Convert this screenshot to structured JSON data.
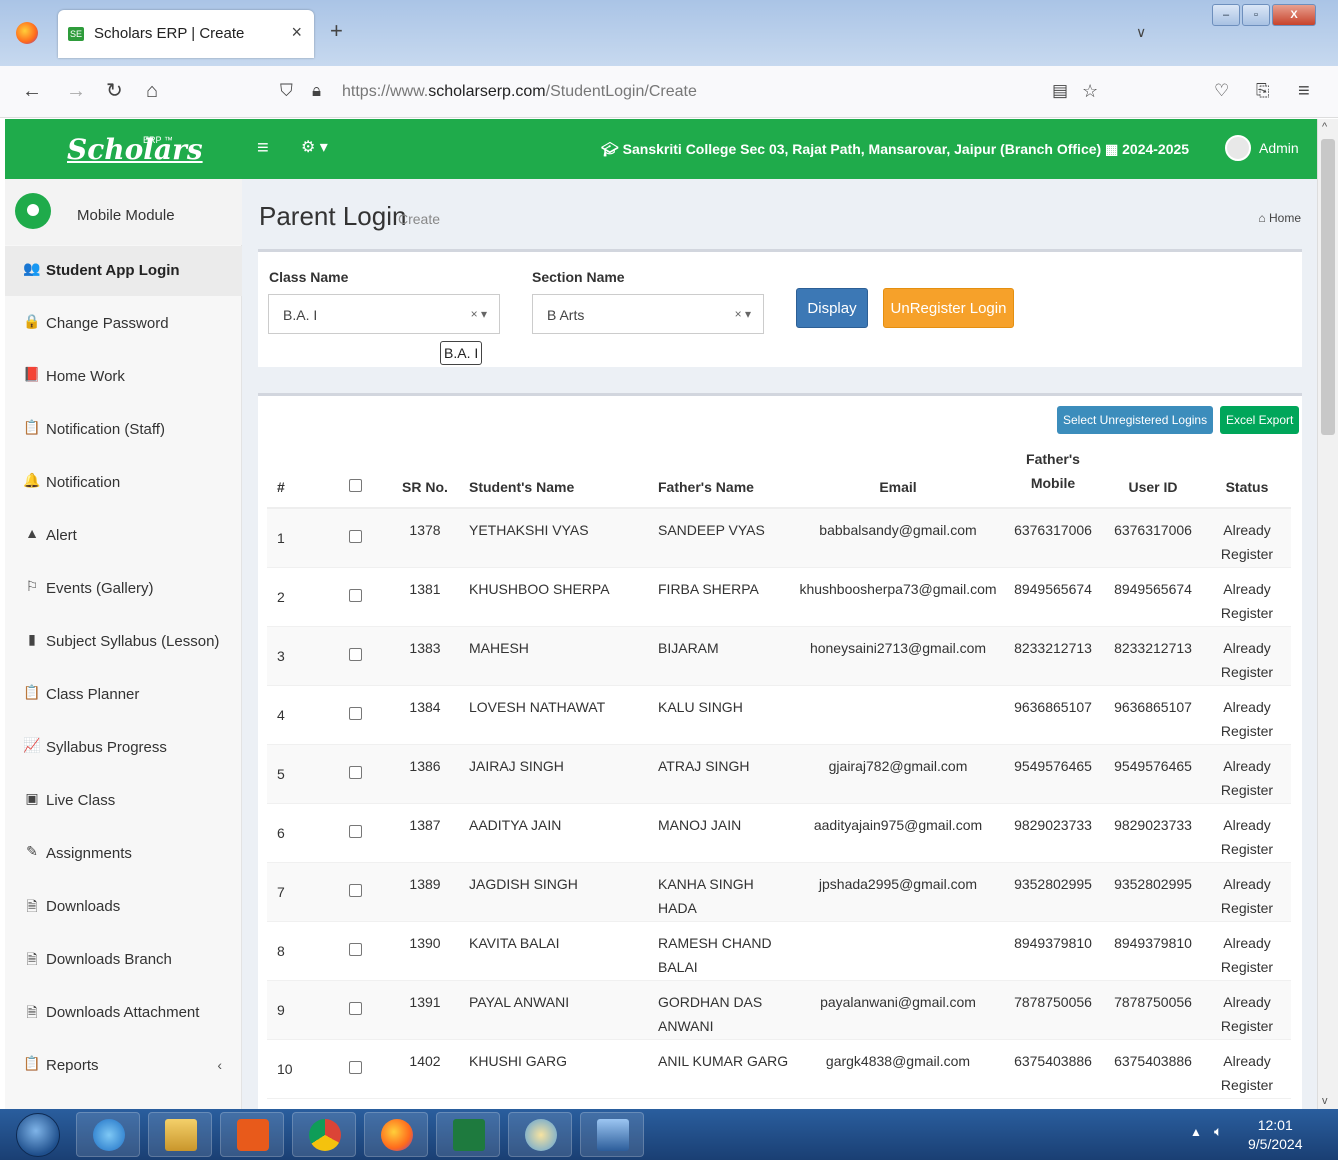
{
  "browser": {
    "tab_title": "Scholars ERP | Create",
    "url_prefix": "https://www.",
    "url_domain": "scholarserp.com",
    "url_path": "/StudentLogin/Create"
  },
  "header": {
    "logo_text": "Scholars",
    "logo_sup": "ERP ™",
    "branch": "Sanskriti College Sec 03, Rajat Path, Mansarovar, Jaipur (Branch Office)",
    "year": "2024-2025",
    "user": "Admin",
    "colors": {
      "brand": "#1fab4b"
    }
  },
  "sidebar": {
    "module": "Mobile Module",
    "items": [
      {
        "label": "Student App Login",
        "icon": "user-plus-icon",
        "glyph": "👥"
      },
      {
        "label": "Change Password",
        "icon": "lock-icon",
        "glyph": "🔒"
      },
      {
        "label": "Home Work",
        "icon": "book-icon",
        "glyph": "📕"
      },
      {
        "label": "Notification (Staff)",
        "icon": "clipboard-icon",
        "glyph": "📋"
      },
      {
        "label": "Notification",
        "icon": "bell-icon",
        "glyph": "🔔"
      },
      {
        "label": "Alert",
        "icon": "alert-icon",
        "glyph": "▲"
      },
      {
        "label": "Events (Gallery)",
        "icon": "flag-icon",
        "glyph": "⚐"
      },
      {
        "label": "Subject Syllabus (Lesson)",
        "icon": "bookmark-icon",
        "glyph": "▮"
      },
      {
        "label": "Class Planner",
        "icon": "clipboard-icon",
        "glyph": "📋"
      },
      {
        "label": "Syllabus Progress",
        "icon": "line-chart-icon",
        "glyph": "📈"
      },
      {
        "label": "Live Class",
        "icon": "video-icon",
        "glyph": "▣"
      },
      {
        "label": "Assignments",
        "icon": "edit-icon",
        "glyph": "✎"
      },
      {
        "label": "Downloads",
        "icon": "file-icon",
        "glyph": "🗎"
      },
      {
        "label": "Downloads Branch",
        "icon": "file-icon",
        "glyph": "🗎"
      },
      {
        "label": "Downloads Attachment",
        "icon": "file-icon",
        "glyph": "🗎"
      },
      {
        "label": "Reports",
        "icon": "clipboard-icon",
        "glyph": "📋",
        "arrow": "‹"
      }
    ]
  },
  "page": {
    "title": "Parent Login",
    "subtitle": "Create",
    "breadcrumb": "Home"
  },
  "filters": {
    "class_label": "Class Name",
    "class_value": "B.A. I",
    "section_label": "Section Name",
    "section_value": "B Arts",
    "tooltip": "B.A. I",
    "clear": "× ▾",
    "display_button": "Display",
    "unregister_button": "UnRegister Login"
  },
  "table": {
    "select_button": "Select Unregistered Logins",
    "export_button": "Excel Export",
    "headers": {
      "idx": "#",
      "sr": "SR No.",
      "student": "Student's Name",
      "father": "Father's Name",
      "email": "Email",
      "mobile": "Father's Mobile",
      "userid": "User ID",
      "status": "Status"
    },
    "rows": [
      {
        "idx": "1",
        "sr": "1378",
        "student": "YETHAKSHI VYAS",
        "father": "SANDEEP VYAS",
        "email": "babbalsandy@gmail.com",
        "mobile": "6376317006",
        "userid": "6376317006",
        "status": "Already Register"
      },
      {
        "idx": "2",
        "sr": "1381",
        "student": "KHUSHBOO SHERPA",
        "father": "FIRBA SHERPA",
        "email": "khushboosherpa73@gmail.com",
        "mobile": "8949565674",
        "userid": "8949565674",
        "status": "Already Register"
      },
      {
        "idx": "3",
        "sr": "1383",
        "student": "MAHESH",
        "father": "BIJARAM",
        "email": "honeysaini2713@gmail.com",
        "mobile": "8233212713",
        "userid": "8233212713",
        "status": "Already Register"
      },
      {
        "idx": "4",
        "sr": "1384",
        "student": "LOVESH NATHAWAT",
        "father": "KALU SINGH",
        "email": "",
        "mobile": "9636865107",
        "userid": "9636865107",
        "status": "Already Register"
      },
      {
        "idx": "5",
        "sr": "1386",
        "student": "JAIRAJ SINGH",
        "father": "ATRAJ SINGH",
        "email": "gjairaj782@gmail.com",
        "mobile": "9549576465",
        "userid": "9549576465",
        "status": "Already Register"
      },
      {
        "idx": "6",
        "sr": "1387",
        "student": "AADITYA JAIN",
        "father": "MANOJ JAIN",
        "email": "aadityajain975@gmail.com",
        "mobile": "9829023733",
        "userid": "9829023733",
        "status": "Already Register"
      },
      {
        "idx": "7",
        "sr": "1389",
        "student": "JAGDISH SINGH",
        "father": "KANHA SINGH HADA",
        "email": "jpshada2995@gmail.com",
        "mobile": "9352802995",
        "userid": "9352802995",
        "status": "Already Register"
      },
      {
        "idx": "8",
        "sr": "1390",
        "student": "KAVITA BALAI",
        "father": "RAMESH CHAND BALAI",
        "email": "",
        "mobile": "8949379810",
        "userid": "8949379810",
        "status": "Already Register"
      },
      {
        "idx": "9",
        "sr": "1391",
        "student": "PAYAL ANWANI",
        "father": "GORDHAN DAS ANWANI",
        "email": "payalanwani@gmail.com",
        "mobile": "7878750056",
        "userid": "7878750056",
        "status": "Already Register"
      },
      {
        "idx": "10",
        "sr": "1402",
        "student": "KHUSHI GARG",
        "father": "ANIL KUMAR GARG",
        "email": "gargk4838@gmail.com",
        "mobile": "6375403886",
        "userid": "6375403886",
        "status": "Already Register"
      }
    ]
  },
  "taskbar": {
    "time": "12:01",
    "date": "9/5/2024"
  }
}
